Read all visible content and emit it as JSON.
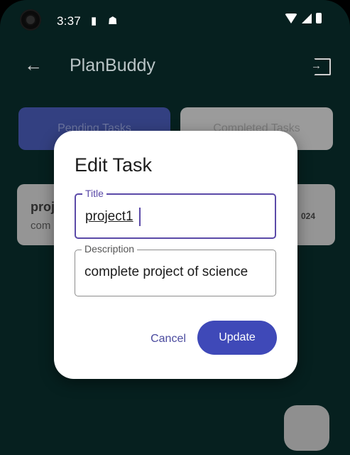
{
  "status_bar": {
    "time": "3:37",
    "icons": [
      "sim-card-icon",
      "debug-icon",
      "wifi-icon",
      "signal-icon",
      "battery-icon"
    ]
  },
  "app_bar": {
    "title": "PlanBuddy",
    "back_icon": "arrow-left-icon",
    "logout_icon": "logout-icon"
  },
  "tabs": [
    {
      "label": "Pending Tasks",
      "active": true
    },
    {
      "label": "Completed Tasks",
      "active": false
    }
  ],
  "task_card": {
    "title": "proj",
    "description": "com",
    "date": "024"
  },
  "dialog": {
    "title": "Edit Task",
    "fields": [
      {
        "label": "Title",
        "value": "project1"
      },
      {
        "label": "Description",
        "value": "complete project of science"
      }
    ],
    "cancel_label": "Cancel",
    "update_label": "Update"
  },
  "colors": {
    "background": "#06201f",
    "accent": "#3f49b8",
    "focus": "#5b4aa8"
  }
}
